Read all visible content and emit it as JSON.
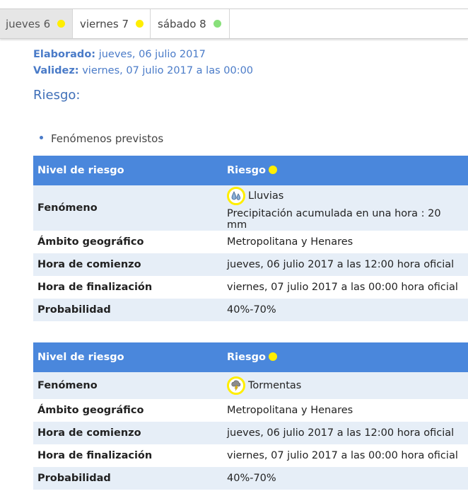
{
  "tabs": [
    {
      "label": "jueves 6",
      "dot_color": "#ffee00",
      "active": true
    },
    {
      "label": "viernes 7",
      "dot_color": "#ffee00",
      "active": false
    },
    {
      "label": "sábado 8",
      "dot_color": "#88e07a",
      "active": false
    }
  ],
  "meta": {
    "elaborado_label": "Elaborado:",
    "elaborado_value": "jueves, 06 julio 2017",
    "validez_label": "Validez:",
    "validez_value": "viernes, 07 julio 2017 a las 00:00"
  },
  "section_title": "Riesgo:",
  "bullet": "Fenómenos previstos",
  "warnings": [
    {
      "header_left": "Nivel de riesgo",
      "header_right": "Riesgo",
      "level_color": "#ffee00",
      "rows": {
        "fenomeno_label": "Fenómeno",
        "fenomeno_value": "Lluvias",
        "fenomeno_icon": "rain-icon",
        "fenomeno_detail": "Precipitación acumulada en una hora : 20 mm",
        "ambito_label": "Ámbito geográfico",
        "ambito_value": "Metropolitana y Henares",
        "comienzo_label": "Hora de comienzo",
        "comienzo_value": "jueves, 06 julio 2017 a las 12:00 hora oficial",
        "fin_label": "Hora de finalización",
        "fin_value": "viernes, 07 julio 2017 a las 00:00 hora oficial",
        "prob_label": "Probabilidad",
        "prob_value": "40%-70%"
      }
    },
    {
      "header_left": "Nivel de riesgo",
      "header_right": "Riesgo",
      "level_color": "#ffee00",
      "rows": {
        "fenomeno_label": "Fenómeno",
        "fenomeno_value": "Tormentas",
        "fenomeno_icon": "storm-icon",
        "ambito_label": "Ámbito geográfico",
        "ambito_value": "Metropolitana y Henares",
        "comienzo_label": "Hora de comienzo",
        "comienzo_value": "jueves, 06 julio 2017 a las 12:00 hora oficial",
        "fin_label": "Hora de finalización",
        "fin_value": "viernes, 07 julio 2017 a las 00:00 hora oficial",
        "prob_label": "Probabilidad",
        "prob_value": "40%-70%"
      }
    }
  ]
}
